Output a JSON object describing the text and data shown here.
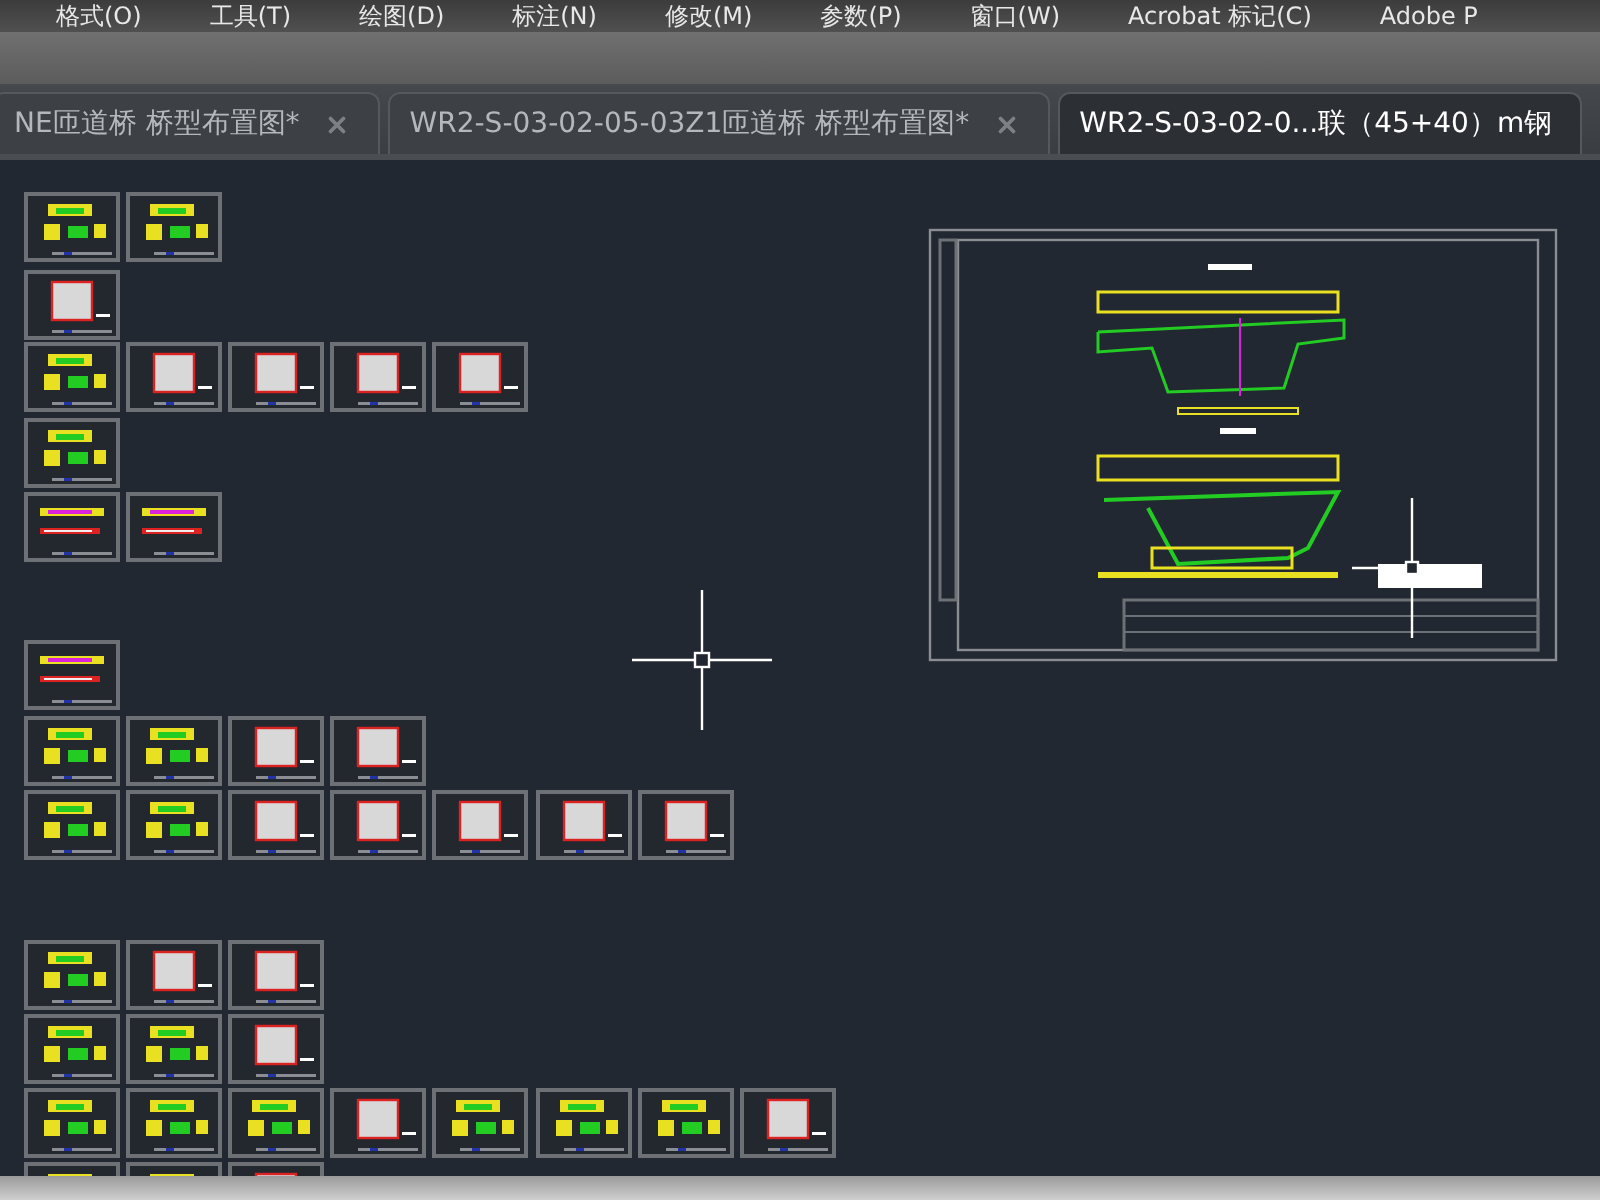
{
  "menu": [
    "格式(O)",
    "工具(T)",
    "绘图(D)",
    "标注(N)",
    "修改(M)",
    "参数(P)",
    "窗口(W)",
    "Acrobat 标记(C)",
    "Adobe P"
  ],
  "tabs": [
    {
      "label": "NE匝道桥 桥型布置图*",
      "selected": false,
      "closable": true
    },
    {
      "label": "WR2-S-03-02-05-03Z1匝道桥 桥型布置图*",
      "selected": false,
      "closable": true
    },
    {
      "label": "WR2-S-03-02-0...联（45+40）m钢",
      "selected": true,
      "closable": false
    }
  ]
}
